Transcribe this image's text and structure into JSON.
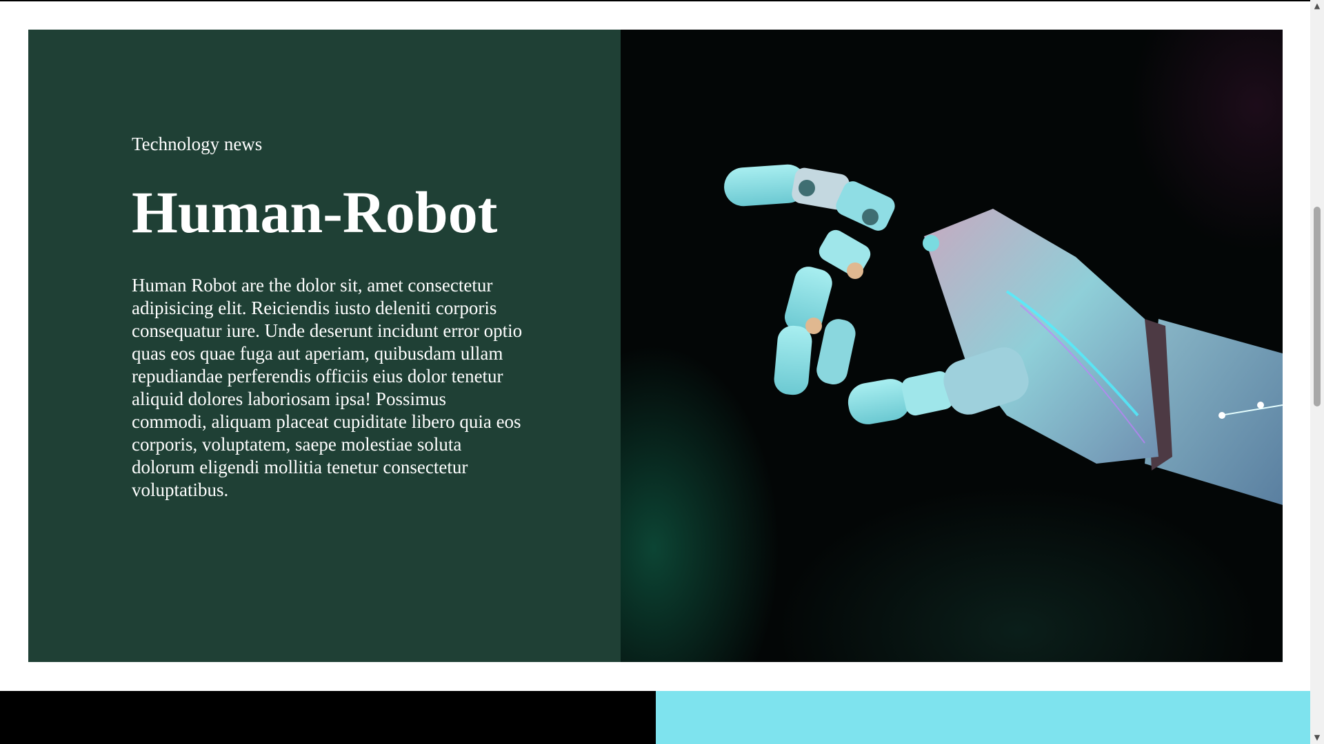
{
  "hero": {
    "kicker": "Technology news",
    "title": "Human-Robot",
    "body": "Human Robot are the dolor sit, amet consectetur adipisicing elit. Reiciendis iusto deleniti corporis consequatur iure. Unde deserunt incidunt error optio quas eos quae fuga aut aperiam, quibusdam ullam repudiandae perferendis officiis eius dolor tenetur aliquid dolores laboriosam ipsa! Possimus commodi, aliquam placeat cupiditate libero quia eos corporis, voluptatem, saepe molestiae soluta dolorum eligendi mollitia tenetur consectetur voluptatibus.",
    "image": "robot-hand-image"
  },
  "colors": {
    "hero_panel": "#1f4035",
    "band_left": "#000000",
    "band_right": "#7ee3ee"
  },
  "scrollbar": {
    "up_icon": "chevron-up-icon",
    "down_icon": "chevron-down-icon"
  }
}
